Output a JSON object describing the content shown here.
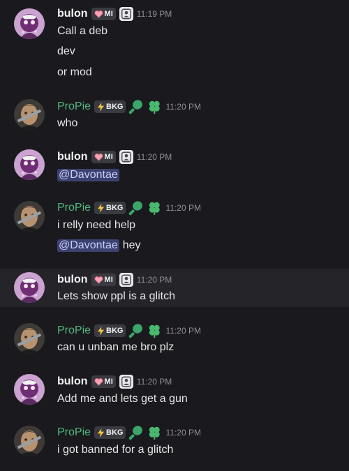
{
  "users": {
    "bulon": {
      "name": "bulon",
      "tag": "MI"
    },
    "propie": {
      "name": "ProPie",
      "tag": "BKG"
    }
  },
  "colors": {
    "background": "#1a1a1e",
    "hover_background": "#242429",
    "propie_name": "#52b67f",
    "mention_bg": "#3c4270",
    "timestamp": "#8e9097"
  },
  "messages": [
    {
      "author": "bulon",
      "time": "11:19 PM",
      "lines": [
        "Call a deb",
        "dev",
        "or mod"
      ]
    },
    {
      "author": "ProPie",
      "time": "11:20 PM",
      "lines": [
        "who"
      ]
    },
    {
      "author": "bulon",
      "time": "11:20 PM",
      "mention": "@Davontae"
    },
    {
      "author": "ProPie",
      "time": "11:20 PM",
      "lines": [
        "i relly need help"
      ],
      "mention_line": {
        "mention": "@Davontae",
        "text": "hey"
      }
    },
    {
      "author": "bulon",
      "time": "11:20 PM",
      "lines": [
        "Lets show ppl is a glitch"
      ],
      "hovered": true
    },
    {
      "author": "ProPie",
      "time": "11:20 PM",
      "lines": [
        "can u unban me bro plz"
      ]
    },
    {
      "author": "bulon",
      "time": "11:20 PM",
      "lines": [
        "Add me and lets get a gun"
      ]
    },
    {
      "author": "ProPie",
      "time": "11:20 PM",
      "lines": [
        "i got banned for a glitch"
      ]
    }
  ]
}
